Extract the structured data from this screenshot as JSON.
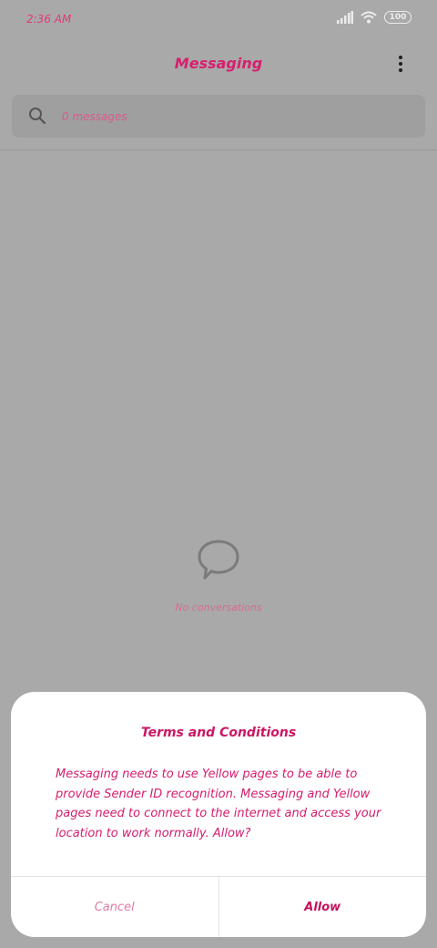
{
  "status_bar": {
    "time": "2:36 AM",
    "battery": "100"
  },
  "app_bar": {
    "title": "Messaging"
  },
  "search": {
    "placeholder": "0 messages"
  },
  "empty_state": {
    "text": "No conversations"
  },
  "dialog": {
    "title": "Terms and Conditions",
    "body": "Messaging needs to use Yellow pages to be able to provide Sender ID recognition. Messaging and Yellow pages need to connect to the internet and access your location to work normally. Allow?",
    "cancel_label": "Cancel",
    "allow_label": "Allow"
  },
  "colors": {
    "accent": "#d71f6e",
    "scrim": "#a9a9a9",
    "dialog_bg": "#ffffff"
  }
}
